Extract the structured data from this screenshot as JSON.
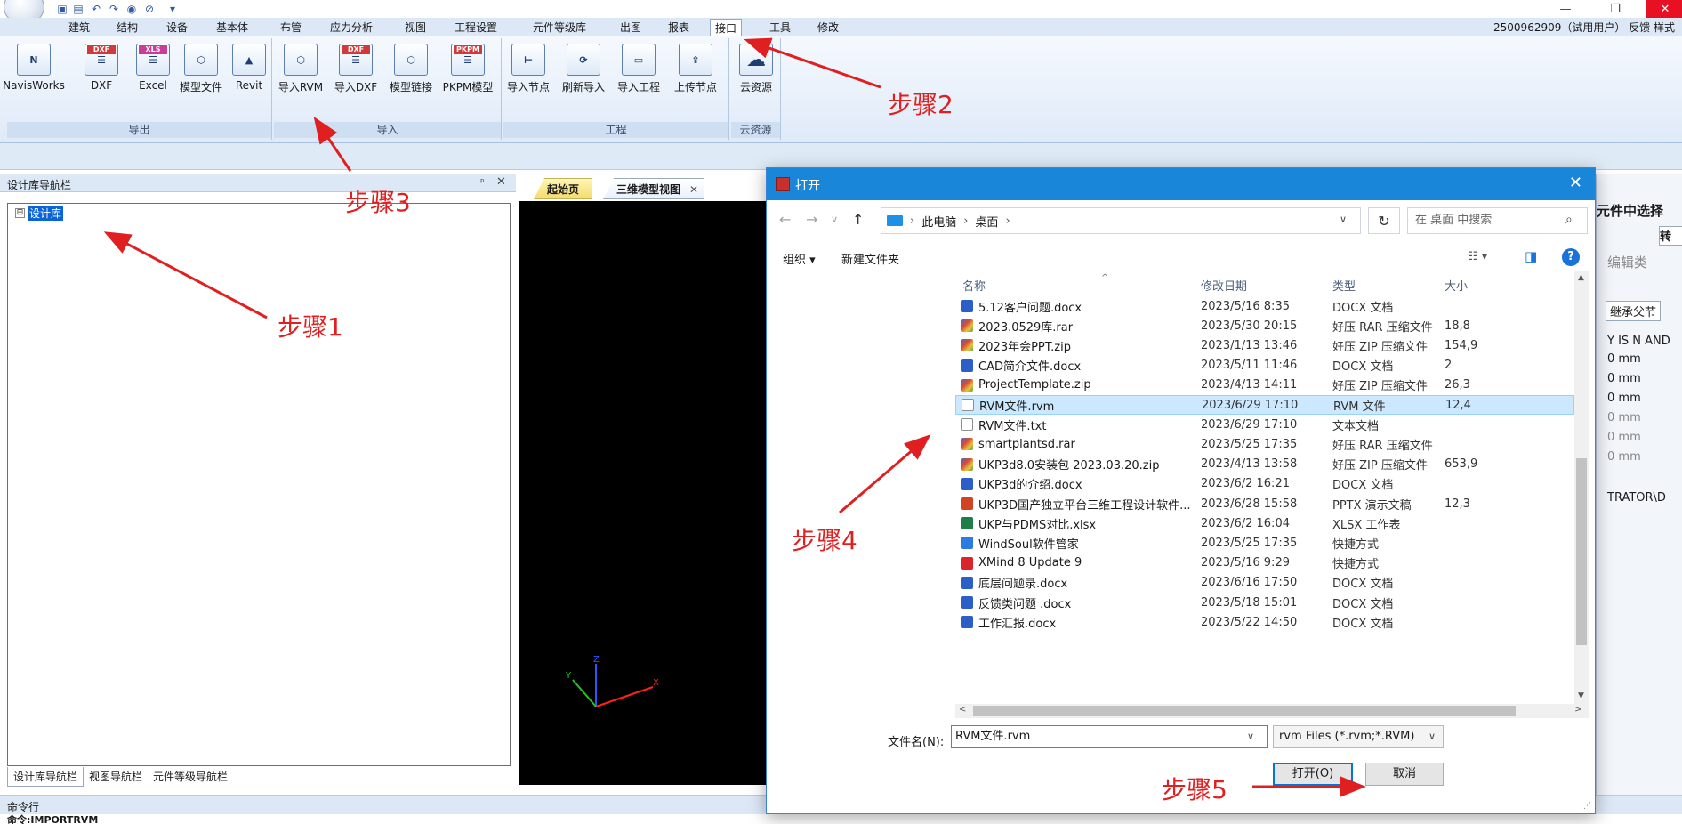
{
  "window": {
    "quick_access_dropdown": "▾",
    "minimize": "—",
    "maximize": "❐",
    "close": "✕"
  },
  "ribbon_tabs": [
    "建筑",
    "结构",
    "设备",
    "基本体",
    "布管",
    "应力分析",
    "视图",
    "工程设置",
    "元件等级库",
    "出图",
    "报表",
    "接口",
    "工具",
    "修改"
  ],
  "active_tab": "接口",
  "user_area": "2500962909（试用用户）  反馈  样式",
  "ribbon_groups": {
    "export": {
      "title": "导出",
      "buttons": [
        {
          "label": "NavisWorks",
          "icon": "navisworks-icon",
          "glyph": "N"
        },
        {
          "label": "DXF",
          "icon": "dxf-icon",
          "glyph": "DXF"
        },
        {
          "label": "Excel",
          "icon": "excel-icon",
          "glyph": "XLS"
        },
        {
          "label": "模型文件",
          "icon": "model-file-icon",
          "glyph": "⬡"
        },
        {
          "label": "Revit",
          "icon": "revit-icon",
          "glyph": "▲"
        }
      ]
    },
    "import": {
      "title": "导入",
      "buttons": [
        {
          "label": "导入RVM",
          "icon": "import-rvm-icon",
          "glyph": "⬡"
        },
        {
          "label": "导入DXF",
          "icon": "import-dxf-icon",
          "glyph": "DXF"
        },
        {
          "label": "模型链接",
          "icon": "model-link-icon",
          "glyph": "⬡"
        },
        {
          "label": "PKPM模型",
          "icon": "pkpm-icon",
          "glyph": "PKPM"
        }
      ]
    },
    "project": {
      "title": "工程",
      "buttons": [
        {
          "label": "导入节点",
          "icon": "import-node-icon",
          "glyph": "⊢"
        },
        {
          "label": "刷新导入",
          "icon": "refresh-import-icon",
          "glyph": "⟳"
        },
        {
          "label": "导入工程",
          "icon": "import-project-icon",
          "glyph": "▭"
        },
        {
          "label": "上传节点",
          "icon": "upload-node-icon",
          "glyph": "⇪"
        }
      ]
    },
    "cloud": {
      "title": "云资源",
      "buttons": [
        {
          "label": "云资源",
          "icon": "cloud-icon",
          "glyph": "☁"
        }
      ]
    }
  },
  "nav_panel": {
    "title": "设计库导航栏",
    "pin": "ᵖ",
    "close": "✕",
    "tree_root_expander": "⊞",
    "tree_root": "设计库",
    "tabs": [
      "设计库导航栏",
      "视图导航栏",
      "元件等级导航栏"
    ]
  },
  "doc_tabs": [
    "起始页",
    "三维模型视图"
  ],
  "doc_tab_close": "✕",
  "axes": {
    "x": "X",
    "y": "Y",
    "z": "Z"
  },
  "command_line": {
    "title": "命令行",
    "text": "命令:IMPORTRVM"
  },
  "right_panel": {
    "header": "元件中选择",
    "convert_btn": "转",
    "edit_btn": "编辑类",
    "inherit_btn": "继承父节",
    "fields": [
      "Y IS N AND",
      "0 mm",
      "0 mm",
      "0 mm",
      "0 mm",
      "0 mm",
      "0 mm",
      "TRATOR\\D"
    ]
  },
  "dialog": {
    "title": "打开",
    "close": "✕",
    "back": "←",
    "forward": "→",
    "recent_drop": "∨",
    "up": "↑",
    "breadcrumb": [
      "此电脑",
      "桌面"
    ],
    "crumb_sep": "›",
    "addr_drop": "∨",
    "refresh": "↻",
    "search_placeholder": "在 桌面 中搜索",
    "organize": "组织 ▾",
    "new_folder": "新建文件夹",
    "view_icon": "☷ ▾",
    "pane_icon": "◨",
    "help": "?",
    "columns": {
      "name": "名称",
      "date": "修改日期",
      "type": "类型",
      "size": "大小"
    },
    "sort_caret": "^",
    "files": [
      {
        "name": "5.12客户问题.docx",
        "date": "2023/5/16 8:35",
        "type": "DOCX 文档",
        "size": "",
        "icon": "ic-docx"
      },
      {
        "name": "2023.0529库.rar",
        "date": "2023/5/30 20:15",
        "type": "好压 RAR 压缩文件",
        "size": "18,8",
        "icon": "ic-rar"
      },
      {
        "name": "2023年会PPT.zip",
        "date": "2023/1/13 13:46",
        "type": "好压 ZIP 压缩文件",
        "size": "154,9",
        "icon": "ic-zip"
      },
      {
        "name": "CAD简介文件.docx",
        "date": "2023/5/11 11:46",
        "type": "DOCX 文档",
        "size": "2",
        "icon": "ic-docx"
      },
      {
        "name": "ProjectTemplate.zip",
        "date": "2023/4/13 14:11",
        "type": "好压 ZIP 压缩文件",
        "size": "26,3",
        "icon": "ic-zip"
      },
      {
        "name": "RVM文件.rvm",
        "date": "2023/6/29 17:10",
        "type": "RVM 文件",
        "size": "12,4",
        "icon": "ic-file",
        "selected": true
      },
      {
        "name": "RVM文件.txt",
        "date": "2023/6/29 17:10",
        "type": "文本文档",
        "size": "",
        "icon": "ic-file"
      },
      {
        "name": "smartplantsd.rar",
        "date": "2023/5/25 17:35",
        "type": "好压 RAR 压缩文件",
        "size": "",
        "icon": "ic-rar"
      },
      {
        "name": "UKP3d8.0安装包 2023.03.20.zip",
        "date": "2023/4/13 13:58",
        "type": "好压 ZIP 压缩文件",
        "size": "653,9",
        "icon": "ic-zip"
      },
      {
        "name": "UKP3d的介绍.docx",
        "date": "2023/6/2 16:21",
        "type": "DOCX 文档",
        "size": "",
        "icon": "ic-docx"
      },
      {
        "name": "UKP3D国产独立平台三维工程设计软件...",
        "date": "2023/6/28 15:58",
        "type": "PPTX 演示文稿",
        "size": "12,3",
        "icon": "ic-pptx"
      },
      {
        "name": "UKP与PDMS对比.xlsx",
        "date": "2023/6/2 16:04",
        "type": "XLSX 工作表",
        "size": "",
        "icon": "ic-xlsx"
      },
      {
        "name": "WindSoul软件管家",
        "date": "2023/5/25 17:35",
        "type": "快捷方式",
        "size": "",
        "icon": "ic-app1"
      },
      {
        "name": "XMind 8 Update 9",
        "date": "2023/5/16 9:29",
        "type": "快捷方式",
        "size": "",
        "icon": "ic-app2"
      },
      {
        "name": "底层问题录.docx",
        "date": "2023/6/16 17:50",
        "type": "DOCX 文档",
        "size": "",
        "icon": "ic-docx"
      },
      {
        "name": "反馈类问题 .docx",
        "date": "2023/5/18 15:01",
        "type": "DOCX 文档",
        "size": "",
        "icon": "ic-docx"
      },
      {
        "name": "工作汇报.docx",
        "date": "2023/5/22 14:50",
        "type": "DOCX 文档",
        "size": "",
        "icon": "ic-docx"
      }
    ],
    "scroll_up": "▲",
    "scroll_down": "▼",
    "scroll_left": "<",
    "scroll_right": ">",
    "filename_label": "文件名(N):",
    "filename_value": "RVM文件.rvm",
    "filename_drop": "∨",
    "filetype_value": "rvm Files (*.rvm;*.RVM)",
    "filetype_drop": "∨",
    "open_btn": "打开(O)",
    "cancel_btn": "取消",
    "grip": "⋰"
  },
  "annotations": {
    "step1": "步骤1",
    "step2": "步骤2",
    "step3": "步骤3",
    "step4": "步骤4",
    "step5": "步骤5"
  },
  "colors": {
    "ribbon_bg": "#dfeaf8",
    "dialog_title": "#1a86d9",
    "selected_row": "#cce8ff",
    "annotation": "#e02020"
  }
}
